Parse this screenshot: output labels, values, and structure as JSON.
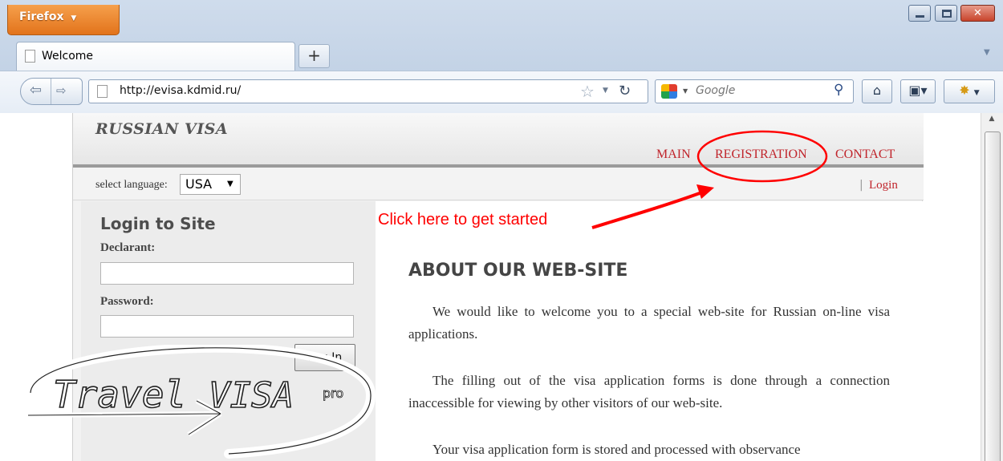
{
  "browser": {
    "app_button": "Firefox",
    "tab_title": "Welcome",
    "new_tab": "+",
    "url": "http://evisa.kdmid.ru/",
    "search_placeholder": "Google",
    "close_glyph": "✕"
  },
  "site": {
    "logo": "RUSSIAN VISA",
    "nav": {
      "main": "MAIN",
      "registration": "REGISTRATION",
      "contact": "CONTACT"
    },
    "language": {
      "label": "select language:",
      "selected": "USA"
    },
    "login_separator": "|",
    "login_link": "Login",
    "login_panel": {
      "title": "Login to Site",
      "declarant_label": "Declarant:",
      "password_label": "Password:",
      "button": "Log In"
    },
    "about": {
      "title": "ABOUT OUR WEB-SITE",
      "p1": "We would like to welcome you to a special web-site for Russian on-line visa applications.",
      "p2": "The filling out of the visa application forms is done through a connection inaccessible for viewing by other visitors of our web-site.",
      "p3": "Your visa application form is stored and processed with observance"
    }
  },
  "annotation": {
    "text": "Click here to get started",
    "color": "#ff0000"
  },
  "watermark": {
    "word1": "Travel",
    "word2": "VISA",
    "word3": "pro"
  },
  "colors": {
    "nav_red": "#c0242b",
    "firefox_orange": "#e2731b"
  }
}
